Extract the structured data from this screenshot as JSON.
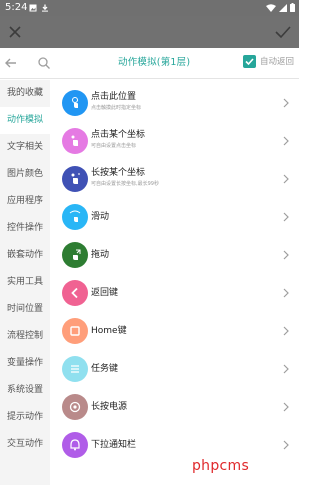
{
  "status_bar": {
    "time": "5:24"
  },
  "panel": {
    "title": "动作模拟(第1层)",
    "auto_return_label": "自动返回",
    "auto_return_checked": true
  },
  "sidebar": {
    "items": [
      {
        "label": "我的收藏",
        "active": false
      },
      {
        "label": "动作模拟",
        "active": true
      },
      {
        "label": "文字相关",
        "active": false
      },
      {
        "label": "图片颜色",
        "active": false
      },
      {
        "label": "应用程序",
        "active": false
      },
      {
        "label": "控件操作",
        "active": false
      },
      {
        "label": "嵌套动作",
        "active": false
      },
      {
        "label": "实用工具",
        "active": false
      },
      {
        "label": "时间位置",
        "active": false
      },
      {
        "label": "流程控制",
        "active": false
      },
      {
        "label": "变量操作",
        "active": false
      },
      {
        "label": "系统设置",
        "active": false
      },
      {
        "label": "提示动作",
        "active": false
      },
      {
        "label": "交互动作",
        "active": false
      }
    ]
  },
  "actions": [
    {
      "title": "点击此位置",
      "subtitle": "点击触摸此时指定坐标",
      "icon": "tap-icon",
      "color": "#2196f3"
    },
    {
      "title": "点击某个坐标",
      "subtitle": "可自由设置点击坐标",
      "icon": "tap-coordinate-icon",
      "color": "#e57ae3"
    },
    {
      "title": "长按某个坐标",
      "subtitle": "可自由设置长按坐标,最长99秒",
      "icon": "long-press-icon",
      "color": "#3f51b5"
    },
    {
      "title": "滑动",
      "subtitle": "",
      "icon": "swipe-icon",
      "color": "#29b6f6"
    },
    {
      "title": "拖动",
      "subtitle": "",
      "icon": "drag-icon",
      "color": "#2e7d32"
    },
    {
      "title": "返回键",
      "subtitle": "",
      "icon": "back-key-icon",
      "color": "#f06292"
    },
    {
      "title": "Home键",
      "subtitle": "",
      "icon": "home-key-icon",
      "color": "#ff9e7a"
    },
    {
      "title": "任务键",
      "subtitle": "",
      "icon": "task-key-icon",
      "color": "#90e0ef"
    },
    {
      "title": "长按电源",
      "subtitle": "",
      "icon": "power-icon",
      "color": "#b98a8a"
    },
    {
      "title": "下拉通知栏",
      "subtitle": "",
      "icon": "notification-icon",
      "color": "#b05de8"
    }
  ],
  "colors": {
    "accent": "#26a69a"
  },
  "watermark": "phpcms"
}
